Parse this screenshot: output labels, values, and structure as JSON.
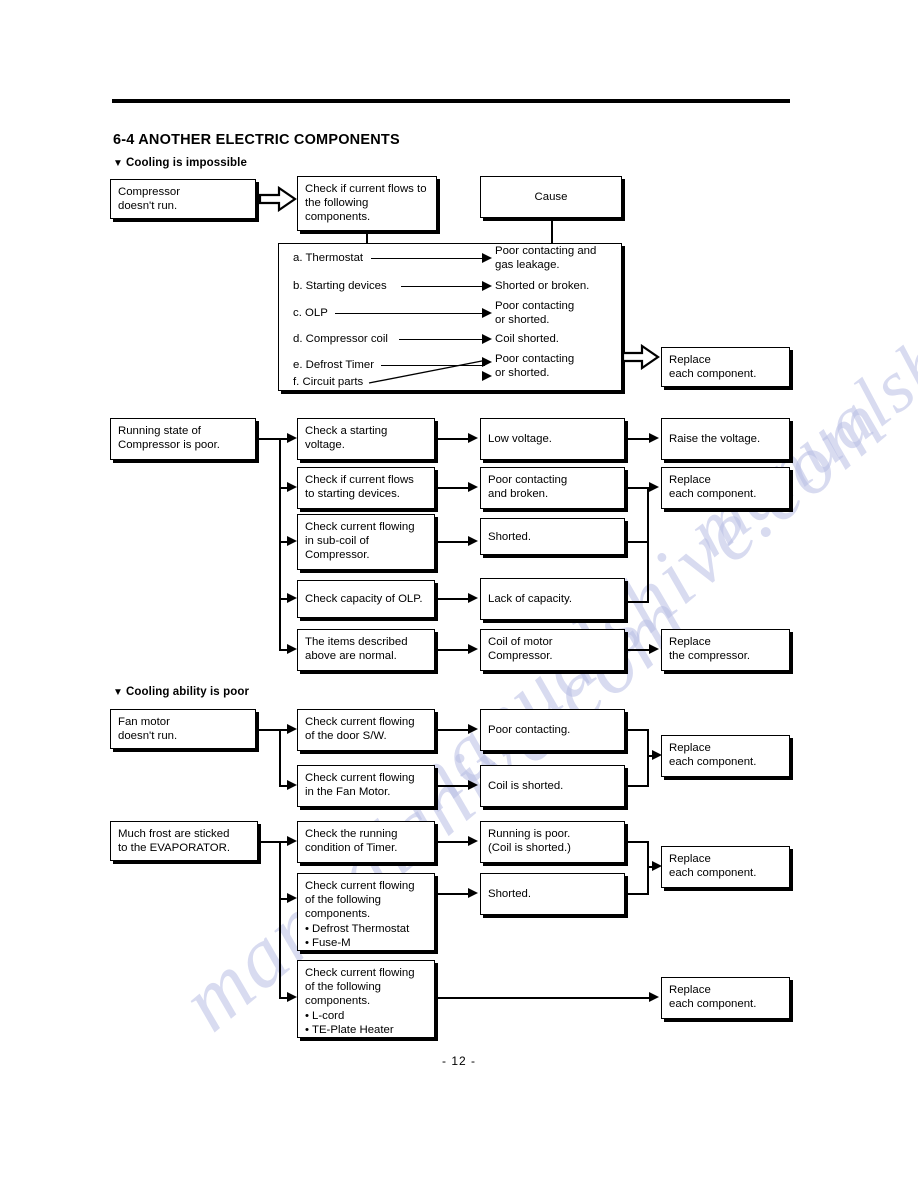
{
  "document": {
    "section_number": "6-4",
    "section_title": "6-4 ANOTHER ELECTRIC COMPONENTS",
    "page_number": "- 12 -",
    "watermark": "manualshive.com"
  },
  "subsections": {
    "cooling_impossible": "Cooling is impossible",
    "cooling_ability_poor": "Cooling ability is poor",
    "marker": "▼"
  },
  "flow1": {
    "symptom": {
      "line1": "Compressor",
      "line2": "doesn't run."
    },
    "check": {
      "line1": "Check if current flows to",
      "line2": "the following",
      "line3": "components."
    },
    "cause_header": "Cause",
    "rows": [
      {
        "component": "a. Thermostat",
        "cause_line1": "Poor contacting and",
        "cause_line2": "gas leakage."
      },
      {
        "component": "b. Starting devices",
        "cause_line1": "Shorted or broken.",
        "cause_line2": ""
      },
      {
        "component": "c. OLP",
        "cause_line1": "Poor contacting",
        "cause_line2": "or shorted."
      },
      {
        "component": "d. Compressor coil",
        "cause_line1": "Coil shorted.",
        "cause_line2": ""
      },
      {
        "component": "e. Defrost Timer",
        "cause_line1": "Poor contacting",
        "cause_line2": "or shorted."
      },
      {
        "component": "f. Circuit parts",
        "cause_line1": "",
        "cause_line2": ""
      }
    ],
    "action": {
      "line1": "Replace",
      "line2": "each component."
    }
  },
  "flow2": {
    "symptom": {
      "line1": "Running state of",
      "line2": "Compressor is poor."
    },
    "rows": [
      {
        "check_lines": [
          "Check a starting",
          "voltage."
        ],
        "cause_lines": [
          "Low voltage."
        ],
        "action_lines": [
          "Raise the voltage."
        ]
      },
      {
        "check_lines": [
          "Check if current flows",
          "to starting devices."
        ],
        "cause_lines": [
          "Poor contacting",
          "and broken."
        ],
        "action_lines": [
          "Replace",
          "each component."
        ]
      },
      {
        "check_lines": [
          "Check current flowing",
          "in sub-coil of",
          "Compressor."
        ],
        "cause_lines": [
          "Shorted."
        ],
        "action_lines": []
      },
      {
        "check_lines": [
          "Check capacity of OLP."
        ],
        "cause_lines": [
          "Lack of capacity."
        ],
        "action_lines": []
      },
      {
        "check_lines": [
          "The items described",
          "above are normal."
        ],
        "cause_lines": [
          "Coil of motor",
          "Compressor."
        ],
        "action_lines": [
          "Replace",
          "the compressor."
        ]
      }
    ]
  },
  "flow3": {
    "symptom": {
      "line1": "Fan motor",
      "line2": "doesn't run."
    },
    "rows": [
      {
        "check_lines": [
          "Check current flowing",
          "of the door S/W."
        ],
        "cause_lines": [
          "Poor contacting."
        ]
      },
      {
        "check_lines": [
          "Check current flowing",
          "in the Fan Motor."
        ],
        "cause_lines": [
          "Coil is shorted."
        ]
      }
    ],
    "action": {
      "line1": "Replace",
      "line2": "each component."
    }
  },
  "flow4": {
    "symptom": {
      "line1": "Much frost are sticked",
      "line2": "to the EVAPORATOR."
    },
    "rows": [
      {
        "check_lines": [
          "Check the running",
          "condition of Timer."
        ],
        "check_bullets": [],
        "cause_lines": [
          "Running is poor.",
          "(Coil is shorted.)"
        ]
      },
      {
        "check_lines": [
          "Check current flowing",
          "of the following",
          "components."
        ],
        "check_bullets": [
          "Defrost Thermostat",
          "Fuse-M"
        ],
        "cause_lines": [
          "Shorted."
        ]
      },
      {
        "check_lines": [
          "Check current flowing",
          "of the following",
          "components."
        ],
        "check_bullets": [
          "L-cord",
          "TE-Plate Heater"
        ],
        "cause_lines": []
      }
    ],
    "action_top": {
      "line1": "Replace",
      "line2": "each component."
    },
    "action_bottom": {
      "line1": "Replace",
      "line2": "each component."
    }
  },
  "colors": {
    "ink": "#000000",
    "paper": "#ffffff",
    "watermark": "#b9bee4"
  }
}
